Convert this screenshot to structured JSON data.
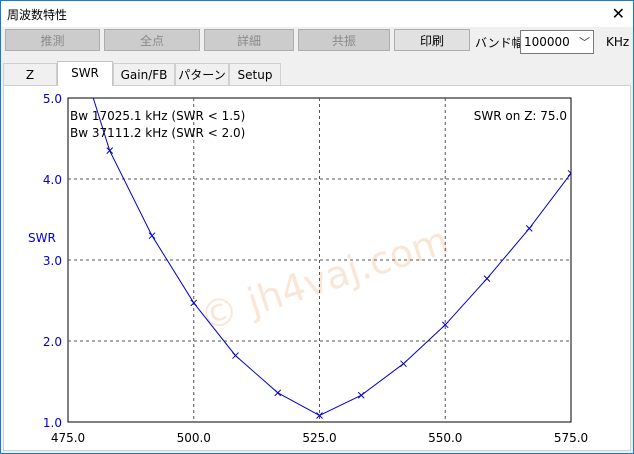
{
  "window": {
    "title": "周波数特性",
    "close_glyph": "✕"
  },
  "toolbar": {
    "buttons": [
      {
        "label": "推測",
        "enabled": false
      },
      {
        "label": "全点",
        "enabled": false
      },
      {
        "label": "詳細",
        "enabled": false
      },
      {
        "label": "共振",
        "enabled": false
      },
      {
        "label": "印刷",
        "enabled": true
      }
    ],
    "band_label": "バンド幅",
    "band_value": "100000",
    "band_unit": "KHz"
  },
  "tabs": [
    {
      "label": "Z",
      "active": false
    },
    {
      "label": "SWR",
      "active": true
    },
    {
      "label": "Gain/FB",
      "active": false
    },
    {
      "label": "パターン",
      "active": false
    },
    {
      "label": "Setup",
      "active": false
    }
  ],
  "plot": {
    "annotations": {
      "bw1": "Bw 17025.1 kHz (SWR < 1.5)",
      "bw2": "Bw 37111.2 kHz (SWR < 2.0)",
      "swr_on_z": "SWR on Z: 75.0"
    },
    "watermark": "© jh4vaj.com"
  },
  "chart_data": {
    "type": "line",
    "title": "",
    "xlabel": "",
    "ylabel": "SWR",
    "xlim": [
      475.0,
      575.0
    ],
    "ylim": [
      1.0,
      5.0
    ],
    "x_ticks": [
      "475.0",
      "500.0",
      "525.0",
      "550.0",
      "575.0"
    ],
    "y_ticks": [
      "1.0",
      "2.0",
      "3.0",
      "4.0",
      "5.0"
    ],
    "grid": true,
    "series": [
      {
        "color": "#0000cc",
        "x": [
          475.0,
          483.3,
          491.7,
          500.0,
          508.3,
          516.7,
          525.0,
          533.3,
          541.7,
          550.0,
          558.3,
          566.7,
          575.0
        ],
        "y": [
          6.0,
          4.35,
          3.3,
          2.47,
          1.82,
          1.36,
          1.08,
          1.33,
          1.72,
          2.2,
          2.77,
          3.39,
          4.07
        ]
      }
    ]
  }
}
